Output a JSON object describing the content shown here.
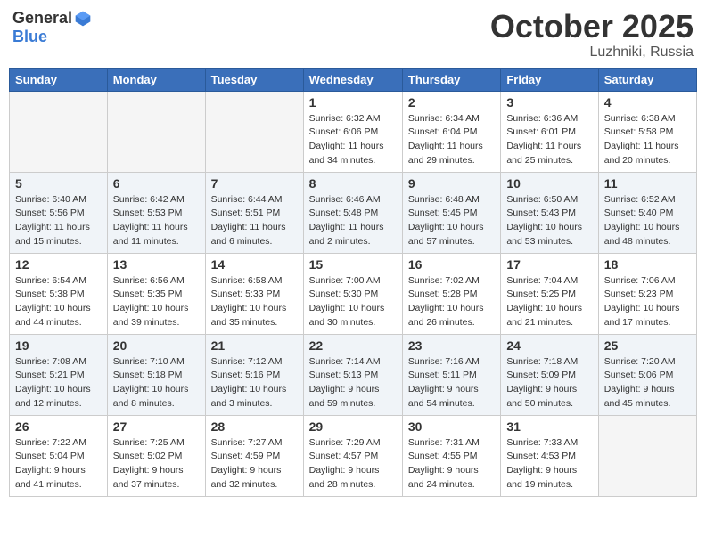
{
  "logo": {
    "general": "General",
    "blue": "Blue"
  },
  "header": {
    "month": "October 2025",
    "location": "Luzhniki, Russia"
  },
  "weekdays": [
    "Sunday",
    "Monday",
    "Tuesday",
    "Wednesday",
    "Thursday",
    "Friday",
    "Saturday"
  ],
  "weeks": [
    [
      {
        "day": "",
        "info": ""
      },
      {
        "day": "",
        "info": ""
      },
      {
        "day": "",
        "info": ""
      },
      {
        "day": "1",
        "info": "Sunrise: 6:32 AM\nSunset: 6:06 PM\nDaylight: 11 hours\nand 34 minutes."
      },
      {
        "day": "2",
        "info": "Sunrise: 6:34 AM\nSunset: 6:04 PM\nDaylight: 11 hours\nand 29 minutes."
      },
      {
        "day": "3",
        "info": "Sunrise: 6:36 AM\nSunset: 6:01 PM\nDaylight: 11 hours\nand 25 minutes."
      },
      {
        "day": "4",
        "info": "Sunrise: 6:38 AM\nSunset: 5:58 PM\nDaylight: 11 hours\nand 20 minutes."
      }
    ],
    [
      {
        "day": "5",
        "info": "Sunrise: 6:40 AM\nSunset: 5:56 PM\nDaylight: 11 hours\nand 15 minutes."
      },
      {
        "day": "6",
        "info": "Sunrise: 6:42 AM\nSunset: 5:53 PM\nDaylight: 11 hours\nand 11 minutes."
      },
      {
        "day": "7",
        "info": "Sunrise: 6:44 AM\nSunset: 5:51 PM\nDaylight: 11 hours\nand 6 minutes."
      },
      {
        "day": "8",
        "info": "Sunrise: 6:46 AM\nSunset: 5:48 PM\nDaylight: 11 hours\nand 2 minutes."
      },
      {
        "day": "9",
        "info": "Sunrise: 6:48 AM\nSunset: 5:45 PM\nDaylight: 10 hours\nand 57 minutes."
      },
      {
        "day": "10",
        "info": "Sunrise: 6:50 AM\nSunset: 5:43 PM\nDaylight: 10 hours\nand 53 minutes."
      },
      {
        "day": "11",
        "info": "Sunrise: 6:52 AM\nSunset: 5:40 PM\nDaylight: 10 hours\nand 48 minutes."
      }
    ],
    [
      {
        "day": "12",
        "info": "Sunrise: 6:54 AM\nSunset: 5:38 PM\nDaylight: 10 hours\nand 44 minutes."
      },
      {
        "day": "13",
        "info": "Sunrise: 6:56 AM\nSunset: 5:35 PM\nDaylight: 10 hours\nand 39 minutes."
      },
      {
        "day": "14",
        "info": "Sunrise: 6:58 AM\nSunset: 5:33 PM\nDaylight: 10 hours\nand 35 minutes."
      },
      {
        "day": "15",
        "info": "Sunrise: 7:00 AM\nSunset: 5:30 PM\nDaylight: 10 hours\nand 30 minutes."
      },
      {
        "day": "16",
        "info": "Sunrise: 7:02 AM\nSunset: 5:28 PM\nDaylight: 10 hours\nand 26 minutes."
      },
      {
        "day": "17",
        "info": "Sunrise: 7:04 AM\nSunset: 5:25 PM\nDaylight: 10 hours\nand 21 minutes."
      },
      {
        "day": "18",
        "info": "Sunrise: 7:06 AM\nSunset: 5:23 PM\nDaylight: 10 hours\nand 17 minutes."
      }
    ],
    [
      {
        "day": "19",
        "info": "Sunrise: 7:08 AM\nSunset: 5:21 PM\nDaylight: 10 hours\nand 12 minutes."
      },
      {
        "day": "20",
        "info": "Sunrise: 7:10 AM\nSunset: 5:18 PM\nDaylight: 10 hours\nand 8 minutes."
      },
      {
        "day": "21",
        "info": "Sunrise: 7:12 AM\nSunset: 5:16 PM\nDaylight: 10 hours\nand 3 minutes."
      },
      {
        "day": "22",
        "info": "Sunrise: 7:14 AM\nSunset: 5:13 PM\nDaylight: 9 hours\nand 59 minutes."
      },
      {
        "day": "23",
        "info": "Sunrise: 7:16 AM\nSunset: 5:11 PM\nDaylight: 9 hours\nand 54 minutes."
      },
      {
        "day": "24",
        "info": "Sunrise: 7:18 AM\nSunset: 5:09 PM\nDaylight: 9 hours\nand 50 minutes."
      },
      {
        "day": "25",
        "info": "Sunrise: 7:20 AM\nSunset: 5:06 PM\nDaylight: 9 hours\nand 45 minutes."
      }
    ],
    [
      {
        "day": "26",
        "info": "Sunrise: 7:22 AM\nSunset: 5:04 PM\nDaylight: 9 hours\nand 41 minutes."
      },
      {
        "day": "27",
        "info": "Sunrise: 7:25 AM\nSunset: 5:02 PM\nDaylight: 9 hours\nand 37 minutes."
      },
      {
        "day": "28",
        "info": "Sunrise: 7:27 AM\nSunset: 4:59 PM\nDaylight: 9 hours\nand 32 minutes."
      },
      {
        "day": "29",
        "info": "Sunrise: 7:29 AM\nSunset: 4:57 PM\nDaylight: 9 hours\nand 28 minutes."
      },
      {
        "day": "30",
        "info": "Sunrise: 7:31 AM\nSunset: 4:55 PM\nDaylight: 9 hours\nand 24 minutes."
      },
      {
        "day": "31",
        "info": "Sunrise: 7:33 AM\nSunset: 4:53 PM\nDaylight: 9 hours\nand 19 minutes."
      },
      {
        "day": "",
        "info": ""
      }
    ]
  ]
}
